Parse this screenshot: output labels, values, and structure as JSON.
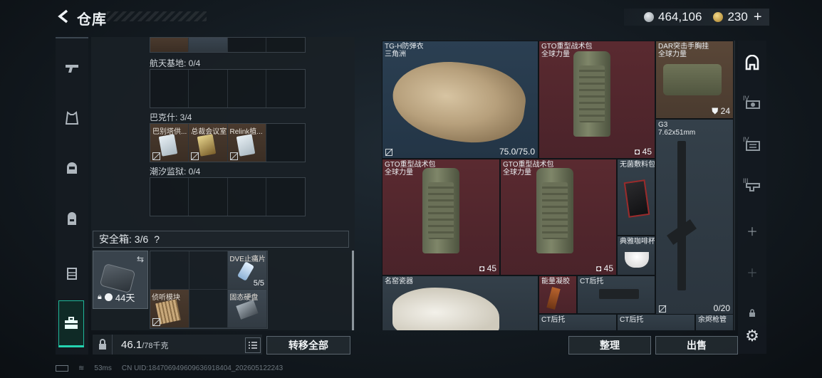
{
  "header": {
    "title": "仓库",
    "currency_silver": "464,106",
    "currency_gold": "230",
    "plus_label": "+"
  },
  "storage": {
    "sections": [
      {
        "label": "航天基地: 0/4"
      },
      {
        "label": "巴克什: 3/4",
        "items": [
          "巴别塔供...",
          "总裁会议室",
          "Relink植..."
        ]
      },
      {
        "label": "潮汐监狱: 0/4"
      }
    ]
  },
  "safe": {
    "header": "安全箱: 3/6",
    "help": "?",
    "days": "44天",
    "items": [
      {
        "name": "DVE止痛片",
        "count": "5/5"
      },
      {
        "name": "侦听模块",
        "count": ""
      },
      {
        "name": "固态硬盘",
        "count": ""
      }
    ]
  },
  "weight": {
    "current": "46.1",
    "max": "/78千克"
  },
  "buttons": {
    "transfer_all": "转移全部",
    "sort": "整理",
    "sell": "出售"
  },
  "stash": {
    "items": [
      {
        "name": "TG-H防弹衣",
        "sub": "三角洲",
        "value": "75.0/75.0"
      },
      {
        "name": "GTO重型战术包",
        "sub": "全球力量",
        "value": "45"
      },
      {
        "name": "DAR突击手胸挂",
        "sub": "全球力量",
        "value": "24"
      },
      {
        "name": "G3",
        "sub": "7.62x51mm",
        "value": "0/20"
      },
      {
        "name": "GTO重型战术包",
        "sub": "全球力量",
        "value": "45"
      },
      {
        "name": "GTO重型战术包",
        "sub": "全球力量",
        "value": "45"
      },
      {
        "name": "无菌敷料包",
        "sub": "",
        "value": ""
      },
      {
        "name": "典雅咖啡杯",
        "sub": "",
        "value": ""
      },
      {
        "name": "名窑瓷器",
        "sub": "",
        "value": ""
      },
      {
        "name": "能量凝胶",
        "sub": "",
        "value": ""
      },
      {
        "name": "CT后托",
        "sub": "",
        "value": ""
      },
      {
        "name": "CT后托",
        "sub": "",
        "value": ""
      },
      {
        "name": "CT后托",
        "sub": "",
        "value": ""
      },
      {
        "name": "余烬枪管",
        "sub": "",
        "value": ""
      }
    ]
  },
  "rail_right": {
    "top_labels": [
      "IV",
      "IV",
      "III"
    ]
  },
  "status": {
    "ping": "53ms",
    "uid": "CN UID:184706949609636918404_202605122243"
  },
  "colors": {
    "accent": "#24d3b0",
    "rare_red": "#5a2a30",
    "rare_blue": "#2b3f52",
    "rare_brown": "#5a4738"
  }
}
